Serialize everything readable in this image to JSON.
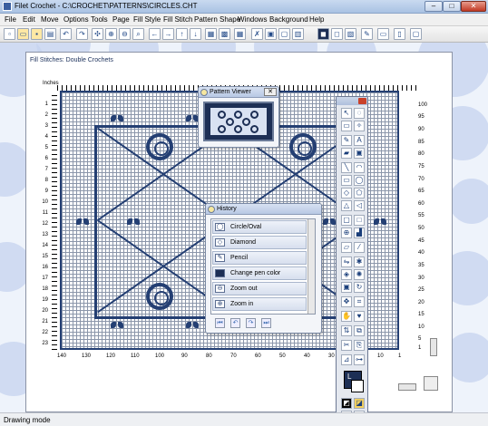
{
  "window": {
    "title": "Filet Crochet - C:\\CROCHET\\PATTERNS\\CIRCLES.CHT",
    "minimize_label": "–",
    "maximize_label": "□",
    "close_label": "✕"
  },
  "menubar": {
    "items": [
      "File",
      "Edit",
      "Move",
      "Options",
      "Tools",
      "Page",
      "Fill Style",
      "Fill Stitch",
      "Pattern Shape",
      "Windows",
      "Background",
      "Help"
    ]
  },
  "toolbar": {
    "buttons": [
      "new-icon",
      "open-icon",
      "save-icon",
      "print-icon",
      "undo-icon",
      "redo-icon",
      "zoom-fit-icon",
      "zoom-in-icon",
      "zoom-out-icon",
      "arrow-left-icon",
      "arrow-right-icon",
      "arrow-up-icon",
      "arrow-down-icon",
      "grid-icon",
      "grid-alt-icon",
      "clear-icon",
      "copy-icon",
      "paste-icon",
      "fill-dark-icon",
      "fill-light-icon",
      "view-icon",
      "edit-icon",
      "window-icon",
      "help-icon"
    ]
  },
  "canvas": {
    "fill_label": "Fill Stitches: Double Crochets",
    "inches_label": "Inches",
    "right_row_labels": [
      "100",
      "95",
      "90",
      "85",
      "80",
      "75",
      "70",
      "65",
      "60",
      "55",
      "50",
      "45",
      "40",
      "35",
      "30",
      "25",
      "20",
      "15",
      "10",
      "5",
      "1"
    ],
    "left_row_labels": [
      "1",
      "2",
      "3",
      "4",
      "5",
      "6",
      "7",
      "8",
      "9",
      "10",
      "11",
      "12",
      "13",
      "14",
      "15",
      "16",
      "17",
      "18",
      "19",
      "20",
      "21",
      "22",
      "23"
    ],
    "col_labels": [
      "140",
      "130",
      "120",
      "110",
      "100",
      "90",
      "80",
      "70",
      "60",
      "50",
      "40",
      "30",
      "20",
      "10",
      "1"
    ]
  },
  "pattern_viewer": {
    "title": "Pattern Viewer",
    "close_label": "✕"
  },
  "history": {
    "title": "History",
    "items": [
      {
        "label": "Circle/Oval",
        "icon": "oval-icon"
      },
      {
        "label": "Diamond",
        "icon": "diamond-icon"
      },
      {
        "label": "Pencil",
        "icon": "pencil-icon"
      },
      {
        "label": "Change pen color",
        "icon": "color-swatch-icon"
      },
      {
        "label": "Zoom out",
        "icon": "zoom-out-icon"
      },
      {
        "label": "Zoom in",
        "icon": "zoom-in-icon"
      }
    ],
    "controls": [
      "first-icon",
      "undo-icon",
      "redo-icon",
      "last-icon"
    ]
  },
  "tool_palette": {
    "tools": [
      "select-icon",
      "lasso-icon",
      "rect-select-icon",
      "wand-icon",
      "pencil-icon",
      "text-icon",
      "fill-icon",
      "bucket-icon",
      "line-icon",
      "curve-icon",
      "rectangle-icon",
      "oval-icon",
      "diamond-icon",
      "polygon-icon",
      "triangle-icon",
      "arrow-shape-icon",
      "rounded-rect-icon",
      "square-icon",
      "globe-icon",
      "stairs-icon",
      "eraser-icon",
      "dropper-icon",
      "mirror-icon",
      "star-icon",
      "frame-icon",
      "rotate-icon",
      "move-icon",
      "crop-icon",
      "hand-icon",
      "heart-icon",
      "flip-icon",
      "copy-icon",
      "cut-icon",
      "paste-icon",
      "filter-icon",
      "link-icon"
    ],
    "pen_label": "L",
    "colors": {
      "pen": "#1d2f55",
      "background": "#ffffff"
    }
  },
  "status": {
    "mode": "Drawing mode"
  },
  "colors": {
    "pattern": "#243f73",
    "grid_line": "#8b96aa",
    "workspace_bg": "#eef3fb",
    "bubble": "#c5d3ef"
  }
}
